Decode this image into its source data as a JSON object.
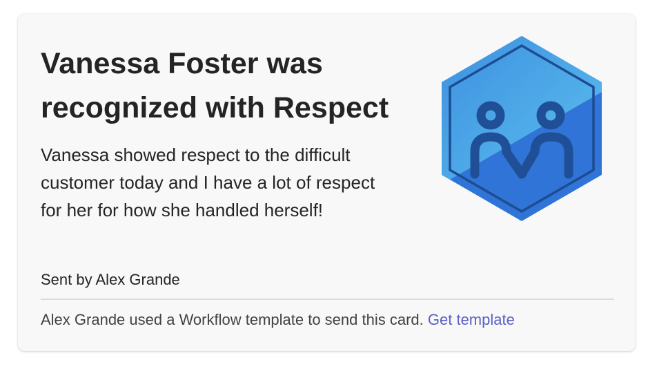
{
  "card": {
    "title": "Vanessa Foster was recognized with Respect",
    "message": "Vanessa showed respect to the difficult customer today and I have a lot of respect for her for how she handled herself!",
    "sender": "Sent by Alex Grande",
    "footer_text": "Alex Grande used a Workflow template to send this card.",
    "footer_link": "Get template",
    "badge_icon": "respect-badge-icon",
    "colors": {
      "background": "#f8f8f9",
      "link": "#5b5fc7",
      "badge_light": "#4aa8e6",
      "badge_dark": "#2f6fd4",
      "badge_figure": "#1f4f96"
    }
  }
}
